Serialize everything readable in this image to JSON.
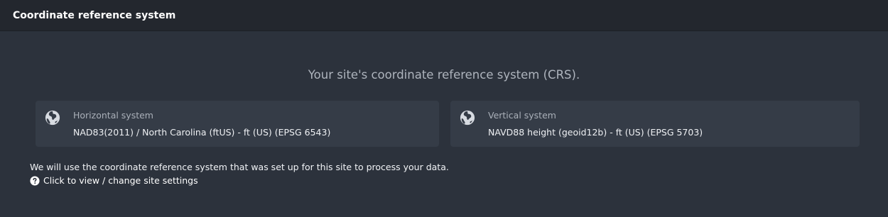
{
  "header": {
    "title": "Coordinate reference system"
  },
  "main": {
    "subtitle": "Your site's coordinate reference system (CRS).",
    "horizontal": {
      "icon": "globe-icon",
      "label": "Horizontal system",
      "value": "NAD83(2011) / North Carolina (ftUS) - ft (US) (EPSG 6543)"
    },
    "vertical": {
      "icon": "globe-icon",
      "label": "Vertical system",
      "value": "NAVD88 height (geoid12b) - ft (US) (EPSG 5703)"
    },
    "note": "We will use the coordinate reference system that was set up for this site to process your data.",
    "settings_link": {
      "icon": "question-circle-icon",
      "label": "Click to view / change site settings"
    }
  },
  "colors": {
    "background": "#2c323c",
    "header_background": "#23272e",
    "card_background": "#353c47",
    "muted_text": "#aab0b9",
    "text": "#eef0f3"
  }
}
